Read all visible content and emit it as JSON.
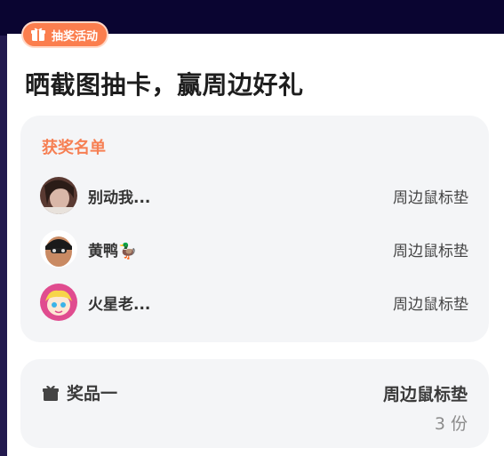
{
  "badge": {
    "label": "抽奖活动",
    "icon": "gift-icon"
  },
  "title": "晒截图抽卡，赢周边好礼",
  "winners": {
    "heading": "获奖名单",
    "items": [
      {
        "name": "别动我...",
        "prize": "周边鼠标垫"
      },
      {
        "name": "黄鸭🦆",
        "prize": "周边鼠标垫"
      },
      {
        "name": "火星老...",
        "prize": "周边鼠标垫"
      }
    ]
  },
  "prize": {
    "label": "奖品一",
    "name": "周边鼠标垫",
    "count": "3 份",
    "icon": "gift-icon"
  },
  "colors": {
    "accent": "#fb7e4e",
    "heading_orange": "#f67f53",
    "top_bar": "#0a0531",
    "card_bg": "#f4f5f7"
  }
}
